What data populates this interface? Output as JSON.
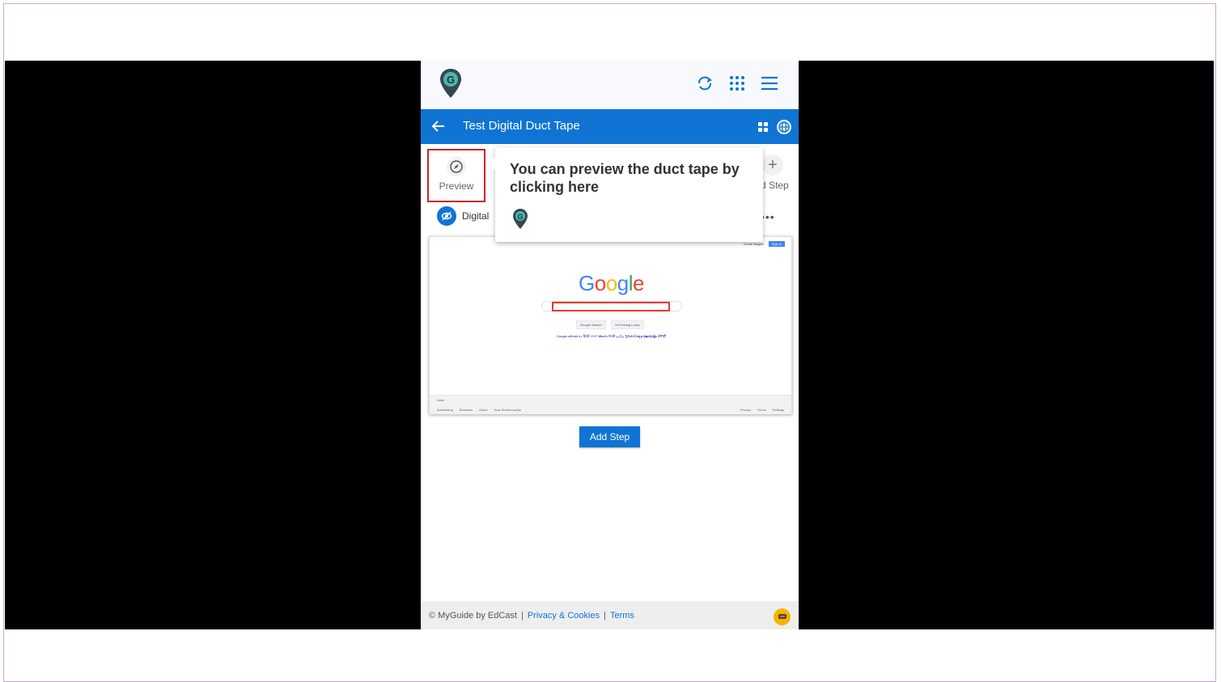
{
  "app": {
    "title": "Test Digital Duct Tape"
  },
  "toolbar": {
    "preview_label": "Preview",
    "add_step_label": "d Step"
  },
  "tag": {
    "label": "Digital"
  },
  "tooltip": {
    "text": "You can preview the duct tape by clicking here"
  },
  "screenshot": {
    "logo_letters": [
      "G",
      "o",
      "o",
      "g",
      "l",
      "e"
    ],
    "logo_colors": [
      "#4285f4",
      "#ea4335",
      "#fbbc05",
      "#4285f4",
      "#34a853",
      "#ea4335"
    ],
    "btn1": "Google Search",
    "btn2": "I'm Feeling Lucky",
    "languages": "Google offered in: हिन्दी বাংলা తెలుగు मराठी தமிழ் ગુજરાતી ಕನ್ನಡ മലയാളം ਪੰਜਾਬੀ",
    "top_links": "Gmail Images",
    "sign_in": "Sign in",
    "country": "India",
    "footer_left": [
      "Advertising",
      "Business",
      "About",
      "How Search works"
    ],
    "footer_right": [
      "Privacy",
      "Terms",
      "Settings"
    ]
  },
  "add_step_button": "Add Step",
  "footer": {
    "copyright": "© MyGuide by EdCast",
    "privacy": "Privacy & Cookies",
    "terms": "Terms"
  },
  "colors": {
    "brand_blue": "#0f74d3",
    "highlight_red": "#c62828",
    "chat_yellow": "#f4b400"
  },
  "icons": [
    "myguide-logo-icon",
    "refresh-icon",
    "apps-grid-icon",
    "hamburger-menu-icon",
    "back-arrow-icon",
    "grid-view-icon",
    "globe-icon",
    "compass-icon",
    "plus-icon",
    "visibility-off-icon",
    "chat-icon"
  ]
}
